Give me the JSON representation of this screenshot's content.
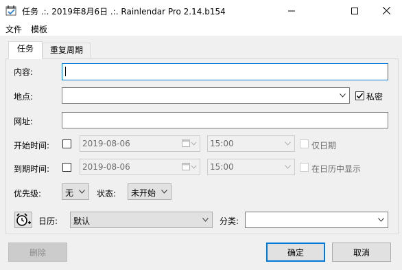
{
  "window": {
    "title": "任务 .:. 2019年8月6日 .:. Rainlendar Pro 2.14.b154"
  },
  "menu": [
    "文件",
    "模板"
  ],
  "tabs": [
    "任务",
    "重复周期"
  ],
  "form": {
    "content_label": "内容:",
    "content_value": "",
    "location_label": "地点:",
    "location_value": "",
    "private_label": "私密",
    "private_checked": true,
    "url_label": "网址:",
    "url_value": "",
    "start_label": "开始时间:",
    "start_date": "2019-08-06",
    "start_time": "15:00",
    "date_only_label": "仅日期",
    "due_label": "到期时间:",
    "due_date": "2019-08-06",
    "due_time": "15:00",
    "show_in_calendar_label": "在日历中显示",
    "priority_label": "优先级:",
    "priority_value": "无",
    "status_label": "状态:",
    "status_value": "未开始",
    "calendar_label": "日历:",
    "calendar_value": "默认",
    "category_label": "分类:",
    "category_value": ""
  },
  "buttons": {
    "delete": "删除",
    "ok": "确定",
    "cancel": "取消"
  },
  "colors": {
    "focus": "#0078d7",
    "window_bg": "#f0f0f0"
  }
}
